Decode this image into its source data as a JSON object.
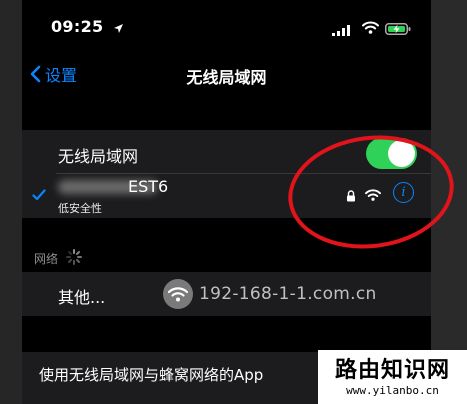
{
  "status_bar": {
    "time": "09:25"
  },
  "nav": {
    "back_label": "设置",
    "title": "无线局域网"
  },
  "wlan": {
    "label": "无线局域网",
    "toggle_on": true,
    "connected_network": {
      "name": "EST6",
      "security_note": "低安全性"
    }
  },
  "networks": {
    "header": "网络",
    "other_label": "其他..."
  },
  "apps_row": {
    "label": "使用无线局域网与蜂窝网络的App"
  },
  "watermark": {
    "text": "192-168-1-1.com.cn"
  },
  "brand": {
    "title": "路由知识网",
    "url": "www.yilanbo.cn"
  },
  "colors": {
    "accent": "#0a84ff",
    "toggle_on": "#30d158",
    "annotation": "#e0141a"
  }
}
